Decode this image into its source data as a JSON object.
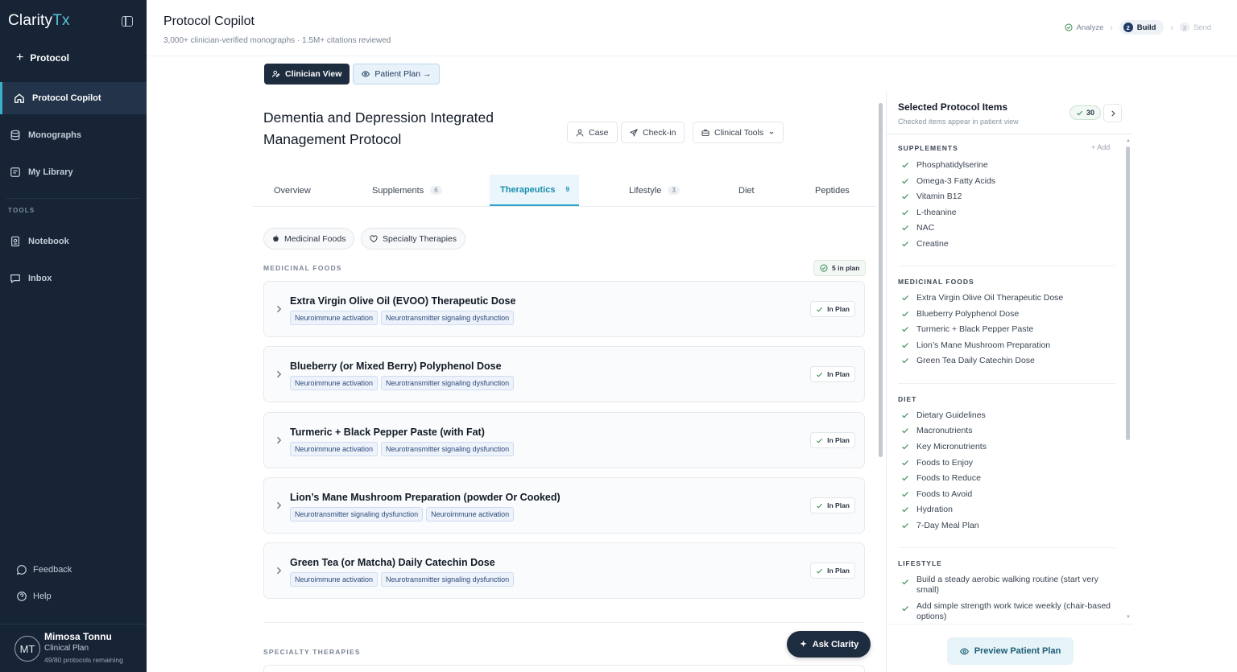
{
  "sidebar": {
    "brand_main": "Clarity",
    "brand_accent": "Tx",
    "new_protocol": "Protocol",
    "nav": [
      {
        "label": "Protocol Copilot",
        "icon": "home-icon"
      },
      {
        "label": "Monographs",
        "icon": "database-icon"
      },
      {
        "label": "My Library",
        "icon": "library-icon"
      }
    ],
    "tools_label": "TOOLS",
    "tools": [
      {
        "label": "Notebook",
        "icon": "notebook-icon"
      },
      {
        "label": "Inbox",
        "icon": "inbox-icon"
      }
    ],
    "feedback": "Feedback",
    "help": "Help",
    "user": {
      "initials": "MT",
      "name": "Mimosa Tonnu",
      "role": "Clinical Plan",
      "quota": "49/80 protocols remaining"
    }
  },
  "header": {
    "title": "Protocol Copilot",
    "subtitle": "3,000+ clinician-verified monographs · 1.5M+ citations reviewed",
    "steps": [
      {
        "num": "",
        "label": "Analyze",
        "state": "done"
      },
      {
        "num": "2",
        "label": "Build",
        "state": "current"
      },
      {
        "num": "3",
        "label": "Send",
        "state": "future"
      }
    ]
  },
  "view_toggle": {
    "clinician": "Clinician View",
    "patient": "Patient Plan →"
  },
  "protocol": {
    "title": "Dementia and Depression Integrated Management Protocol",
    "actions": {
      "case": "Case",
      "checkin": "Check-in",
      "tools": "Clinical Tools"
    }
  },
  "tabs": [
    {
      "label": "Overview",
      "count": ""
    },
    {
      "label": "Supplements",
      "count": "6"
    },
    {
      "label": "Therapeutics",
      "count": "9"
    },
    {
      "label": "Lifestyle",
      "count": "3"
    },
    {
      "label": "Diet",
      "count": ""
    },
    {
      "label": "Peptides",
      "count": ""
    }
  ],
  "filters": {
    "medicinal_foods": "Medicinal Foods",
    "specialty_therapies": "Specialty Therapies"
  },
  "medicinal_foods": {
    "label": "MEDICINAL FOODS",
    "in_plan_count": "5 in plan",
    "status_label": "In Plan",
    "items": [
      {
        "title": "Extra Virgin Olive Oil (EVOO) Therapeutic Dose",
        "tags": [
          "Neuroimmune activation",
          "Neurotransmitter signaling dysfunction"
        ]
      },
      {
        "title": "Blueberry (or Mixed Berry) Polyphenol Dose",
        "tags": [
          "Neuroimmune activation",
          "Neurotransmitter signaling dysfunction"
        ]
      },
      {
        "title": "Turmeric + Black Pepper Paste (with Fat)",
        "tags": [
          "Neuroimmune activation",
          "Neurotransmitter signaling dysfunction"
        ]
      },
      {
        "title": "Lion’s Mane Mushroom Preparation (powder Or Cooked)",
        "tags": [
          "Neurotransmitter signaling dysfunction",
          "Neuroimmune activation"
        ]
      },
      {
        "title": "Green Tea (or Matcha) Daily Catechin Dose",
        "tags": [
          "Neuroimmune activation",
          "Neurotransmitter signaling dysfunction"
        ]
      }
    ]
  },
  "specialty_therapies": {
    "label": "SPECIALTY THERAPIES"
  },
  "ask_clarity": "Ask Clarity",
  "panel": {
    "title": "Selected Protocol Items",
    "subtitle": "Checked items appear in patient view",
    "count": "30",
    "add_label": "+ Add",
    "sections": [
      {
        "label": "SUPPLEMENTS",
        "items": [
          "Phosphatidylserine",
          "Omega-3 Fatty Acids",
          "Vitamin B12",
          "L-theanine",
          "NAC",
          "Creatine"
        ]
      },
      {
        "label": "MEDICINAL FOODS",
        "items": [
          "Extra Virgin Olive Oil Therapeutic Dose",
          "Blueberry Polyphenol Dose",
          "Turmeric + Black Pepper Paste",
          "Lion’s Mane Mushroom Preparation",
          "Green Tea Daily Catechin Dose"
        ]
      },
      {
        "label": "DIET",
        "items": [
          "Dietary Guidelines",
          "Macronutrients",
          "Key Micronutrients",
          "Foods to Enjoy",
          "Foods to Reduce",
          "Foods to Avoid",
          "Hydration",
          "7-Day Meal Plan"
        ]
      },
      {
        "label": "LIFESTYLE",
        "items": [
          "Build a steady aerobic walking routine (start very small)",
          "Add simple strength work twice weekly (chair-based options)"
        ]
      }
    ],
    "preview_button": "Preview Patient Plan"
  },
  "colors": {
    "sidebar_bg": "#172436",
    "accent": "#2aa3c6",
    "check_green": "#3f8f5a",
    "dark_button": "#1e2c40"
  }
}
